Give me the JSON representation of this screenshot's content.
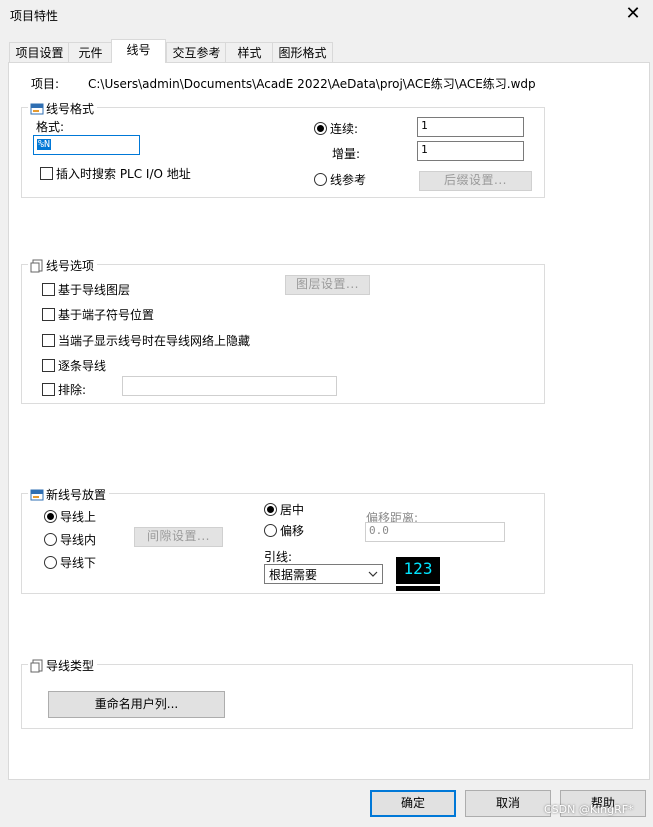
{
  "window": {
    "title": "项目特性",
    "close_glyph": "✕"
  },
  "tabs": [
    {
      "label": "项目设置"
    },
    {
      "label": "元件"
    },
    {
      "label": "线号"
    },
    {
      "label": "交互参考"
    },
    {
      "label": "样式"
    },
    {
      "label": "图形格式"
    }
  ],
  "active_tab": "线号",
  "project": {
    "label": "项目:",
    "path": "C:\\Users\\admin\\Documents\\AcadE 2022\\AeData\\proj\\ACE练习\\ACE练习.wdp"
  },
  "wire_number_format": {
    "title": "线号格式",
    "format_label": "格式:",
    "format_value": "%N",
    "insert_search_label": "插入时搜索 PLC I/O 地址",
    "sequential_label": "连续:",
    "sequential_value": "1",
    "increment_label": "增量:",
    "increment_value": "1",
    "line_ref_label": "线参考",
    "suffix_button": "后缀设置..."
  },
  "wire_number_options": {
    "title": "线号选项",
    "layer_button": "图层设置...",
    "options": [
      {
        "label": "基于导线图层"
      },
      {
        "label": "基于端子符号位置"
      },
      {
        "label": "当端子显示线号时在导线网络上隐藏"
      },
      {
        "label": "逐条导线"
      },
      {
        "label": "排除:"
      }
    ],
    "exclude_value": ""
  },
  "new_wire_placement": {
    "title": "新线号放置",
    "above_label": "导线上",
    "inline_label": "导线内",
    "below_label": "导线下",
    "gap_button": "间隙设置...",
    "center_label": "居中",
    "offset_label": "偏移",
    "offset_distance_label": "偏移距离:",
    "offset_distance_value": "0.0",
    "leader_label": "引线:",
    "leader_value": "根据需要",
    "preview_text": "123"
  },
  "wire_type": {
    "title": "导线类型",
    "rename_button": "重命名用户列..."
  },
  "footer": {
    "ok": "确定",
    "cancel": "取消",
    "help": "帮助",
    "watermark": "CSDN @KingRF*"
  },
  "colors": {
    "accent": "#0078d7",
    "preview_bg": "#000000",
    "preview_fg": "#00e5ff"
  },
  "icons": {
    "group": "property-group-icon",
    "close": "close-icon",
    "dropdown": "chevron-down-icon"
  }
}
